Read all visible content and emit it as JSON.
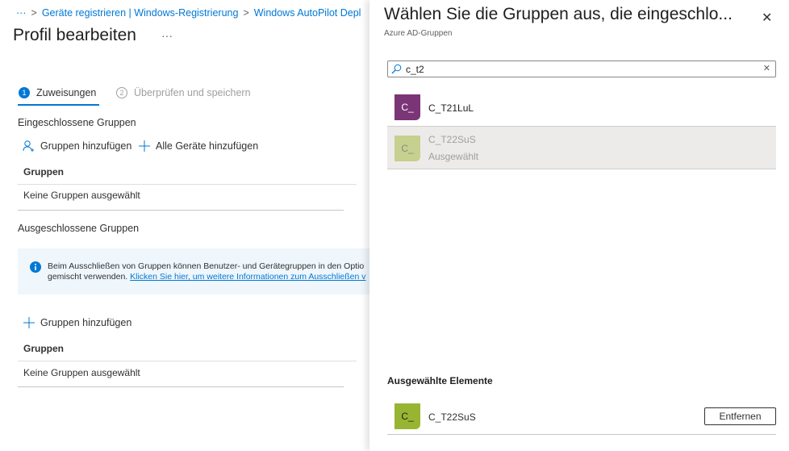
{
  "breadcrumb": {
    "ellipsis": "···",
    "items": [
      "Geräte registrieren | Windows-Registrierung",
      "Windows AutoPilot Depl"
    ]
  },
  "page": {
    "title": "Profil bearbeiten",
    "more": "···"
  },
  "steps": [
    {
      "num": "1",
      "label": "Zuweisungen",
      "active": true
    },
    {
      "num": "2",
      "label": "Überprüfen und speichern",
      "active": false
    }
  ],
  "included": {
    "heading": "Eingeschlossene Gruppen",
    "add_groups": "Gruppen hinzufügen",
    "add_all_devices": "Alle Geräte hinzufügen",
    "column": "Gruppen",
    "empty": "Keine Gruppen ausgewählt"
  },
  "excluded": {
    "heading": "Ausgeschlossene Gruppen",
    "info_line1": "Beim Ausschließen von Gruppen können Benutzer- und Gerätegruppen in den Optio",
    "info_line2": "gemischt verwenden.",
    "info_link": "Klicken Sie hier, um weitere Informationen zum Ausschließen v",
    "add_groups": "Gruppen hinzufügen",
    "column": "Gruppen",
    "empty": "Keine Gruppen ausgewählt"
  },
  "panel": {
    "title": "Wählen Sie die Gruppen aus, die eingeschlo...",
    "subtitle": "Azure AD-Gruppen",
    "search_value": "c_t2",
    "results": [
      {
        "initials": "C_",
        "name": "C_T21LuL",
        "color": "#7a3577"
      },
      {
        "initials": "C_",
        "name": "C_T22SuS",
        "status": "Ausgewählt",
        "color": "#c6d08f"
      }
    ],
    "selected_heading": "Ausgewählte Elemente",
    "selected": [
      {
        "initials": "C_",
        "name": "C_T22SuS",
        "color": "#98b532"
      }
    ],
    "remove_label": "Entfernen"
  },
  "colors": {
    "accent": "#0078d4"
  }
}
